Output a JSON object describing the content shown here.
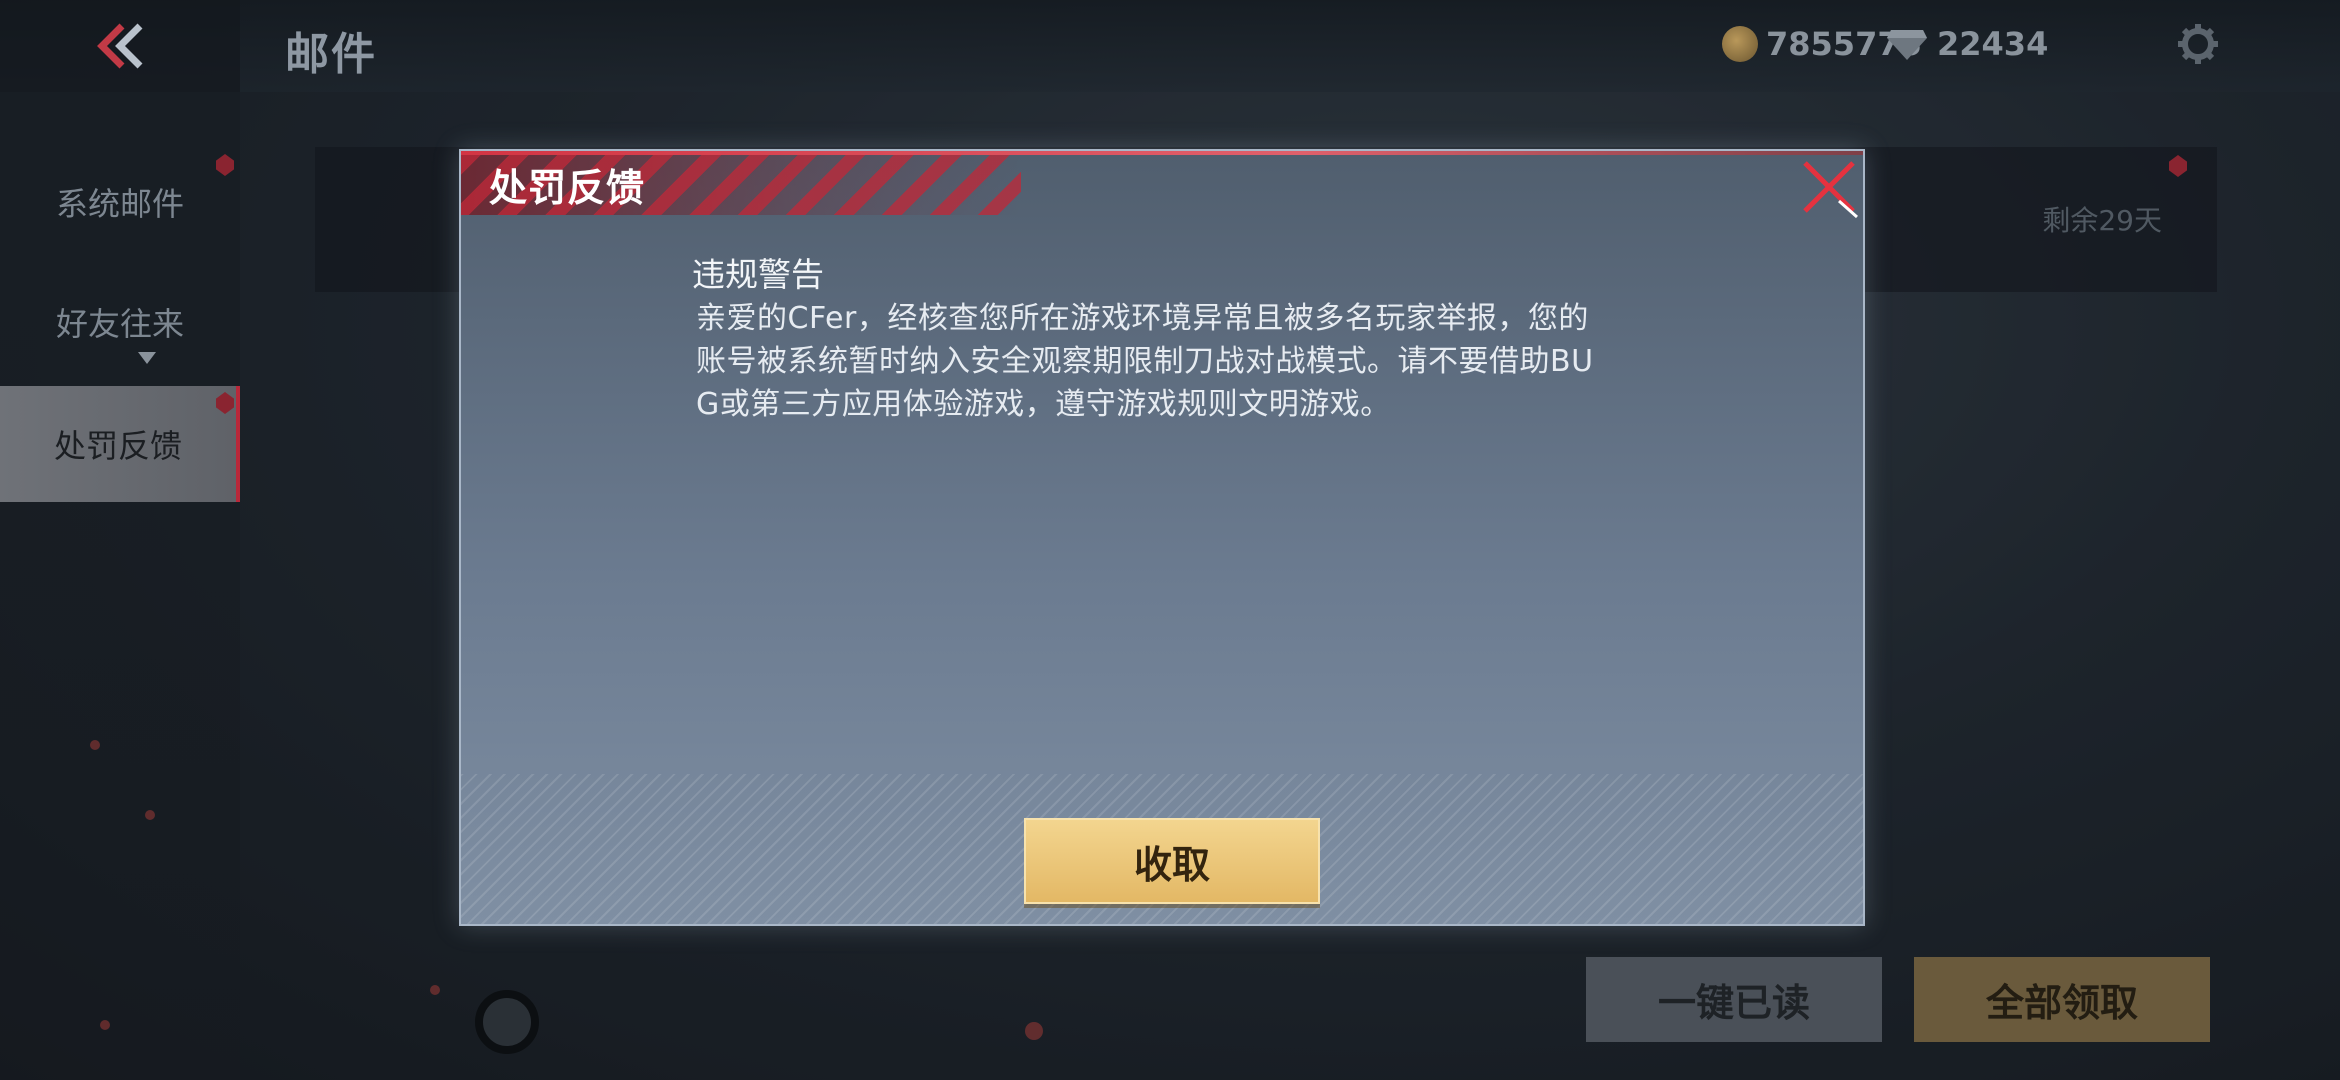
{
  "header": {
    "title": "邮件",
    "gold_amount": "7855775",
    "diamond_amount": "22434"
  },
  "sidebar": {
    "items": [
      {
        "label": "系统邮件"
      },
      {
        "label": "好友往来"
      },
      {
        "label": "处罚反馈"
      }
    ]
  },
  "mail_list": {
    "row_remaining": "剩余29天"
  },
  "footer": {
    "read_all_label": "一键已读",
    "claim_all_label": "全部领取"
  },
  "modal": {
    "title": "处罚反馈",
    "message_title": "违规警告",
    "message_lines": [
      "亲爱的CFer，经核查您所在游戏环境异常且被多名玩家举报，您的",
      "账号被系统暂时纳入安全观察期限制刀战对战模式。请不要借助BU",
      "G或第三方应用体验游戏，遵守游戏规则文明游戏。"
    ],
    "collect_label": "收取"
  },
  "colors": {
    "accent_red": "#d33544",
    "gold_button": "#e3b865"
  }
}
